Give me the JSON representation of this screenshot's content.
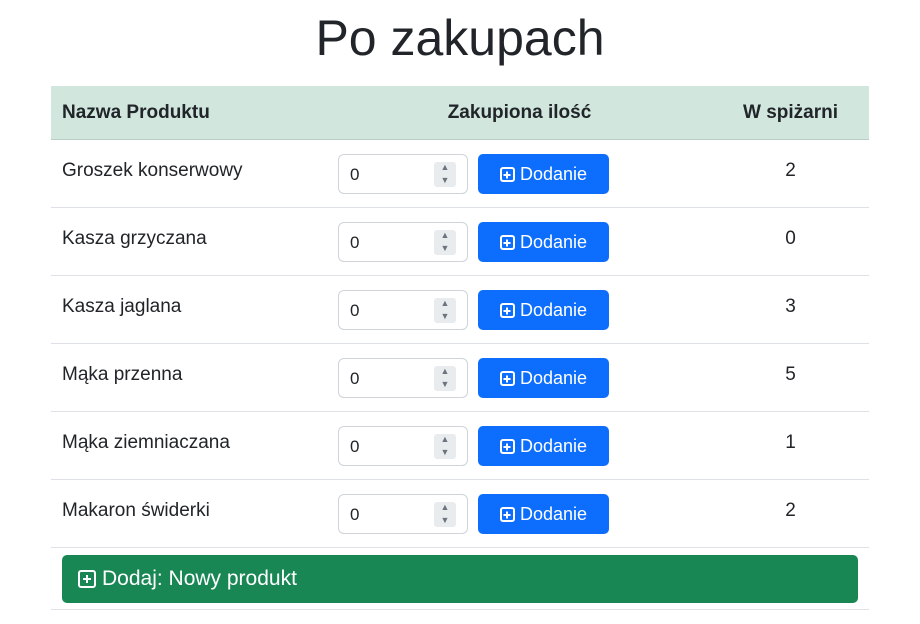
{
  "page": {
    "title": "Po zakupach"
  },
  "table": {
    "headers": {
      "name": "Nazwa Produktu",
      "quantity": "Zakupiona ilość",
      "pantry": "W spiżarni"
    },
    "rows": [
      {
        "name": "Groszek konserwowy",
        "quantity": "0",
        "add_label": "Dodanie",
        "pantry": "2"
      },
      {
        "name": "Kasza grzyczana",
        "quantity": "0",
        "add_label": "Dodanie",
        "pantry": "0"
      },
      {
        "name": "Kasza jaglana",
        "quantity": "0",
        "add_label": "Dodanie",
        "pantry": "3"
      },
      {
        "name": "Mąka przenna",
        "quantity": "0",
        "add_label": "Dodanie",
        "pantry": "5"
      },
      {
        "name": "Mąka ziemniaczana",
        "quantity": "0",
        "add_label": "Dodanie",
        "pantry": "1"
      },
      {
        "name": "Makaron świderki",
        "quantity": "0",
        "add_label": "Dodanie",
        "pantry": "2"
      }
    ]
  },
  "footer": {
    "new_product_label": "Dodaj: Nowy produkt"
  },
  "icons": {
    "add": "plus-square-icon",
    "spinner": "spinner-arrows-icon"
  },
  "colors": {
    "header_bg": "#d1e7dd",
    "primary": "#0d6efd",
    "success": "#198754"
  }
}
